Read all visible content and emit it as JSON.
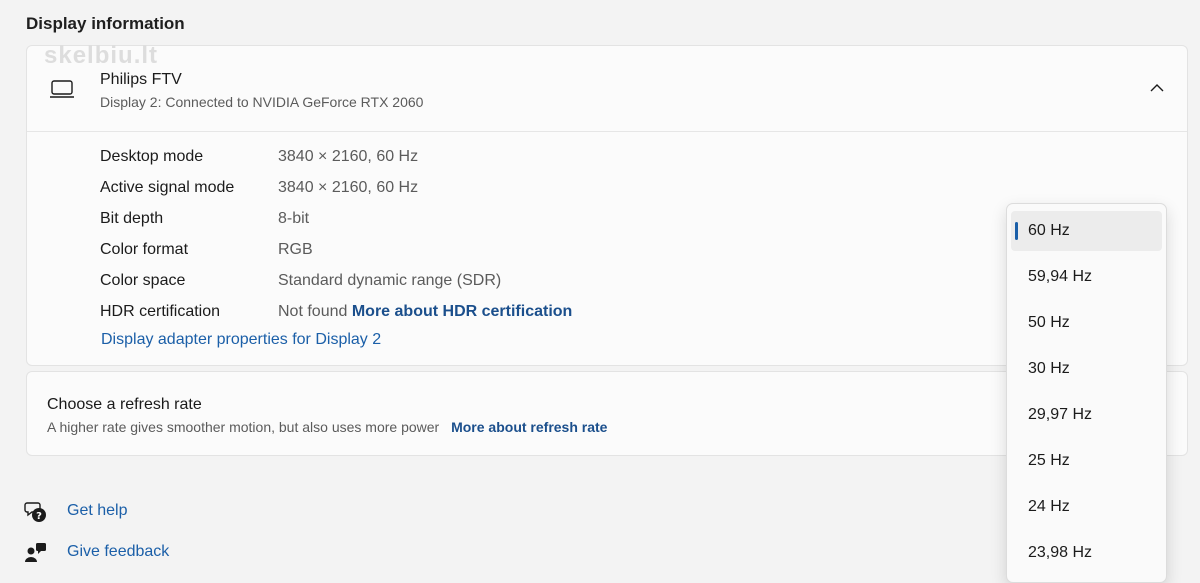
{
  "section": {
    "title": "Display information"
  },
  "watermark": "skelbiu.lt",
  "display": {
    "name": "Philips FTV",
    "subtitle": "Display 2: Connected to NVIDIA GeForce RTX 2060",
    "rows": [
      {
        "label": "Desktop mode",
        "value": "3840 × 2160, 60 Hz"
      },
      {
        "label": "Active signal mode",
        "value": "3840 × 2160, 60 Hz"
      },
      {
        "label": "Bit depth",
        "value": "8-bit"
      },
      {
        "label": "Color format",
        "value": "RGB"
      },
      {
        "label": "Color space",
        "value": "Standard dynamic range (SDR)"
      },
      {
        "label": "HDR certification",
        "value": "Not found",
        "link": "More about HDR certification"
      }
    ],
    "adapter_link": "Display adapter properties for Display 2"
  },
  "refresh": {
    "title": "Choose a refresh rate",
    "subtitle": "A higher rate gives smoother motion, but also uses more power",
    "link": "More about refresh rate",
    "options": [
      "60 Hz",
      "59,94 Hz",
      "50 Hz",
      "30 Hz",
      "29,97 Hz",
      "25 Hz",
      "24 Hz",
      "23,98 Hz"
    ],
    "selected": "60 Hz"
  },
  "help": {
    "get_help": "Get help",
    "give_feedback": "Give feedback"
  },
  "colors": {
    "accent": "#1b5fa8",
    "link_dark": "#1b4f8c",
    "background": "#f3f3f3"
  }
}
